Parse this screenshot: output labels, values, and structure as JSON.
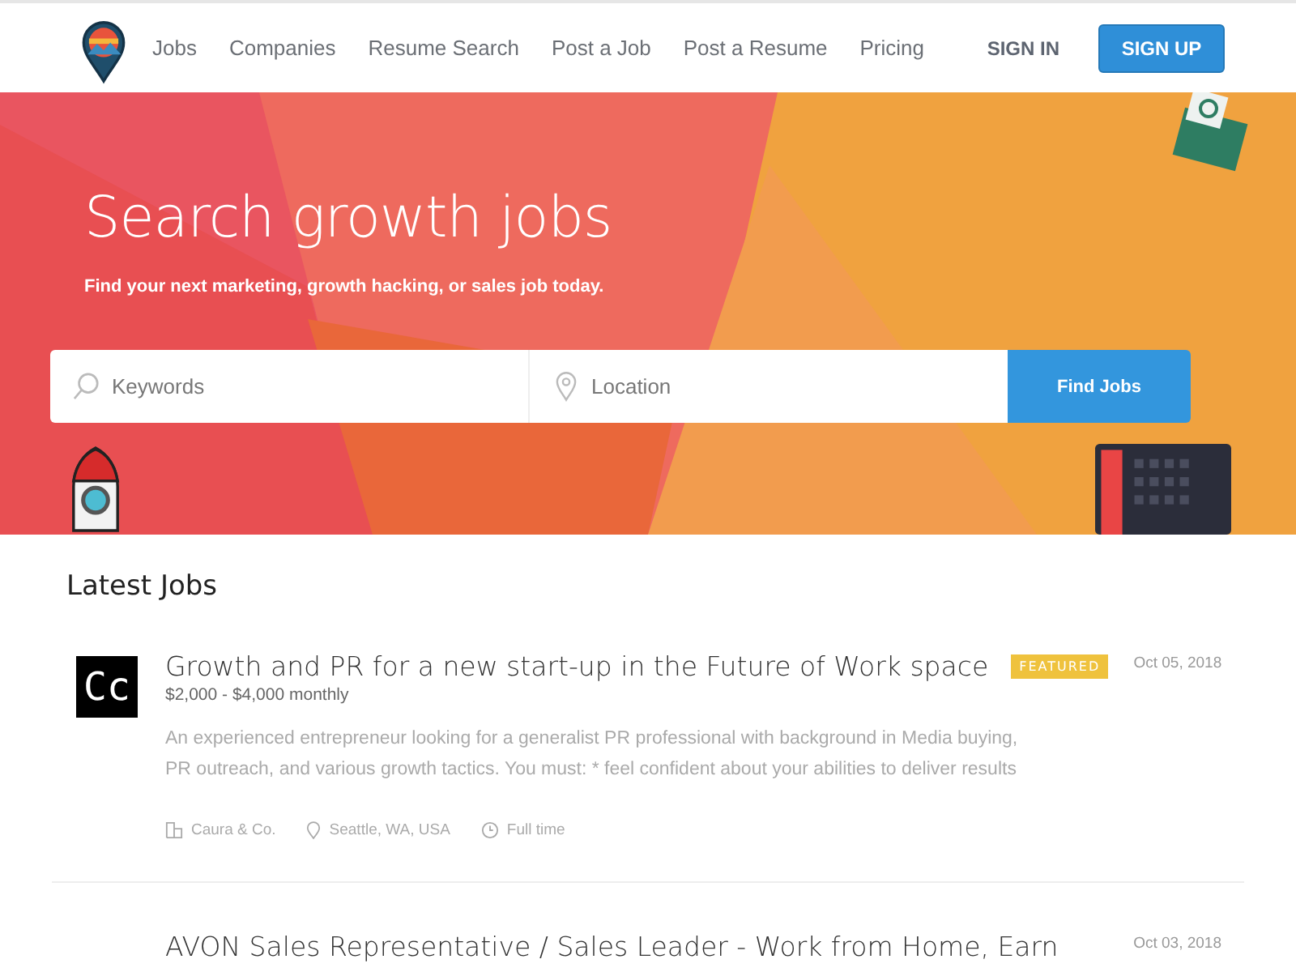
{
  "nav": {
    "links": [
      {
        "label": "Jobs"
      },
      {
        "label": "Companies"
      },
      {
        "label": "Resume Search"
      },
      {
        "label": "Post a Job"
      },
      {
        "label": "Post a Resume"
      },
      {
        "label": "Pricing"
      }
    ],
    "sign_in": "SIGN IN",
    "sign_up": "SIGN UP"
  },
  "hero": {
    "title": "Search growth jobs",
    "subtitle": "Find your next marketing, growth hacking, or sales job today.",
    "keywords": {
      "placeholder": "Keywords"
    },
    "location": {
      "placeholder": "Location"
    },
    "button": "Find Jobs"
  },
  "section_title": "Latest Jobs",
  "jobs": [
    {
      "logo": "Cc",
      "title": "Growth and PR for a new start-up in the Future of Work space",
      "featured": true,
      "featured_label": "FEATURED",
      "salary": "$2,000 - $4,000 monthly",
      "date": "Oct 05, 2018",
      "description": "An experienced entrepreneur looking for a generalist PR professional with background in Media buying, PR outreach, and various growth tactics. You must: * feel confident about your abilities to deliver results",
      "company": "Caura & Co.",
      "location": "Seattle, WA, USA",
      "type": "Full time"
    },
    {
      "title": "AVON Sales Representative / Sales Leader - Work from Home, Earn",
      "featured": false,
      "date": "Oct 03, 2018"
    }
  ]
}
